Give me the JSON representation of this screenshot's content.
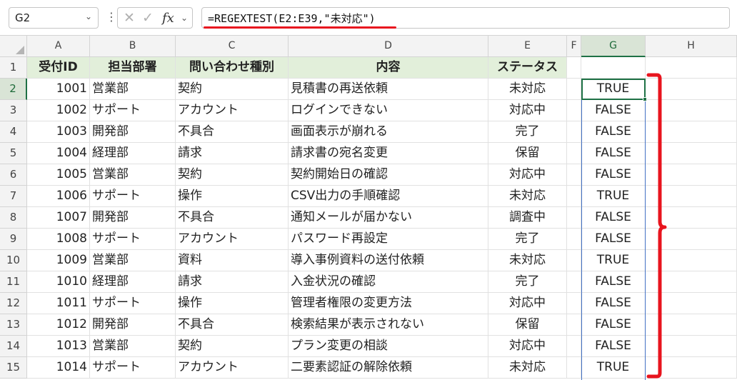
{
  "name_box": {
    "value": "G2"
  },
  "formula_bar": {
    "formula": "=REGEXTEST(E2:E39,\"未対応\")"
  },
  "columns": [
    "A",
    "B",
    "C",
    "D",
    "E",
    "F",
    "G",
    "H"
  ],
  "rows": [
    "1",
    "2",
    "3",
    "4",
    "5",
    "6",
    "7",
    "8",
    "9",
    "10",
    "11",
    "12",
    "13",
    "14",
    "15"
  ],
  "header": [
    "受付ID",
    "担当部署",
    "問い合わせ種別",
    "内容",
    "ステータス"
  ],
  "data": [
    {
      "id": "1001",
      "dept": "営業部",
      "type": "契約",
      "content": "見積書の再送依頼",
      "status": "未対応",
      "result": "TRUE"
    },
    {
      "id": "1002",
      "dept": "サポート",
      "type": "アカウント",
      "content": "ログインできない",
      "status": "対応中",
      "result": "FALSE"
    },
    {
      "id": "1003",
      "dept": "開発部",
      "type": "不具合",
      "content": "画面表示が崩れる",
      "status": "完了",
      "result": "FALSE"
    },
    {
      "id": "1004",
      "dept": "経理部",
      "type": "請求",
      "content": "請求書の宛名変更",
      "status": "保留",
      "result": "FALSE"
    },
    {
      "id": "1005",
      "dept": "営業部",
      "type": "契約",
      "content": "契約開始日の確認",
      "status": "対応中",
      "result": "FALSE"
    },
    {
      "id": "1006",
      "dept": "サポート",
      "type": "操作",
      "content": "CSV出力の手順確認",
      "status": "未対応",
      "result": "TRUE"
    },
    {
      "id": "1007",
      "dept": "開発部",
      "type": "不具合",
      "content": "通知メールが届かない",
      "status": "調査中",
      "result": "FALSE"
    },
    {
      "id": "1008",
      "dept": "サポート",
      "type": "アカウント",
      "content": "パスワード再設定",
      "status": "完了",
      "result": "FALSE"
    },
    {
      "id": "1009",
      "dept": "営業部",
      "type": "資料",
      "content": "導入事例資料の送付依頼",
      "status": "未対応",
      "result": "TRUE"
    },
    {
      "id": "1010",
      "dept": "経理部",
      "type": "請求",
      "content": "入金状況の確認",
      "status": "完了",
      "result": "FALSE"
    },
    {
      "id": "1011",
      "dept": "サポート",
      "type": "操作",
      "content": "管理者権限の変更方法",
      "status": "対応中",
      "result": "FALSE"
    },
    {
      "id": "1012",
      "dept": "開発部",
      "type": "不具合",
      "content": "検索結果が表示されない",
      "status": "保留",
      "result": "FALSE"
    },
    {
      "id": "1013",
      "dept": "営業部",
      "type": "契約",
      "content": "プラン変更の相談",
      "status": "対応中",
      "result": "FALSE"
    },
    {
      "id": "1014",
      "dept": "サポート",
      "type": "アカウント",
      "content": "二要素認証の解除依頼",
      "status": "未対応",
      "result": "TRUE"
    }
  ],
  "accent": {
    "excel_green": "#1e7145",
    "header_fill": "#e2efda",
    "annotation_red": "#e8141e",
    "spill_border": "#4472c4"
  }
}
